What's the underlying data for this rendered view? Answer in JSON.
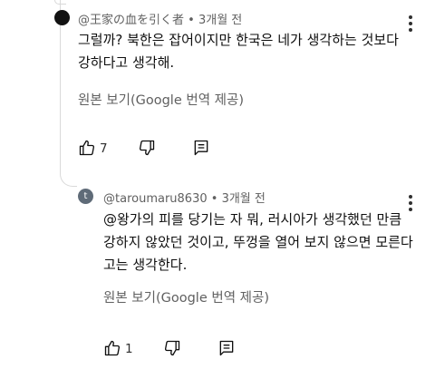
{
  "comments": [
    {
      "author": "@王家の血を引く者",
      "meta": "• 3개월 전",
      "text": "그럴까? 북한은 잡어이지만 한국은 네가 생각하는 것보다 강하다고 생각해.",
      "translate_label": "원본 보기(Google 번역 제공)",
      "likes": "7",
      "icons": [
        "like-icon",
        "dislike-icon",
        "reply-icon",
        "more-vert-icon"
      ]
    },
    {
      "author": "@taroumaru8630",
      "meta": "• 3개월 전",
      "avatar_letter": "t",
      "text": "@왕가의 피를 당기는 자 뭐, 러시아가 생각했던 만큼 강하지 않았던 것이고, 뚜껑을 열어 보지 않으면 모른다고는 생각한다.",
      "translate_label": "원본 보기(Google 번역 제공)",
      "likes": "1",
      "icons": [
        "like-icon",
        "dislike-icon",
        "reply-icon",
        "more-vert-icon"
      ]
    }
  ],
  "colors": {
    "text": "#0f0f0f",
    "secondary": "#606060",
    "thread_line": "#d9d9d9",
    "avatar_reply": "#5f6b78"
  }
}
